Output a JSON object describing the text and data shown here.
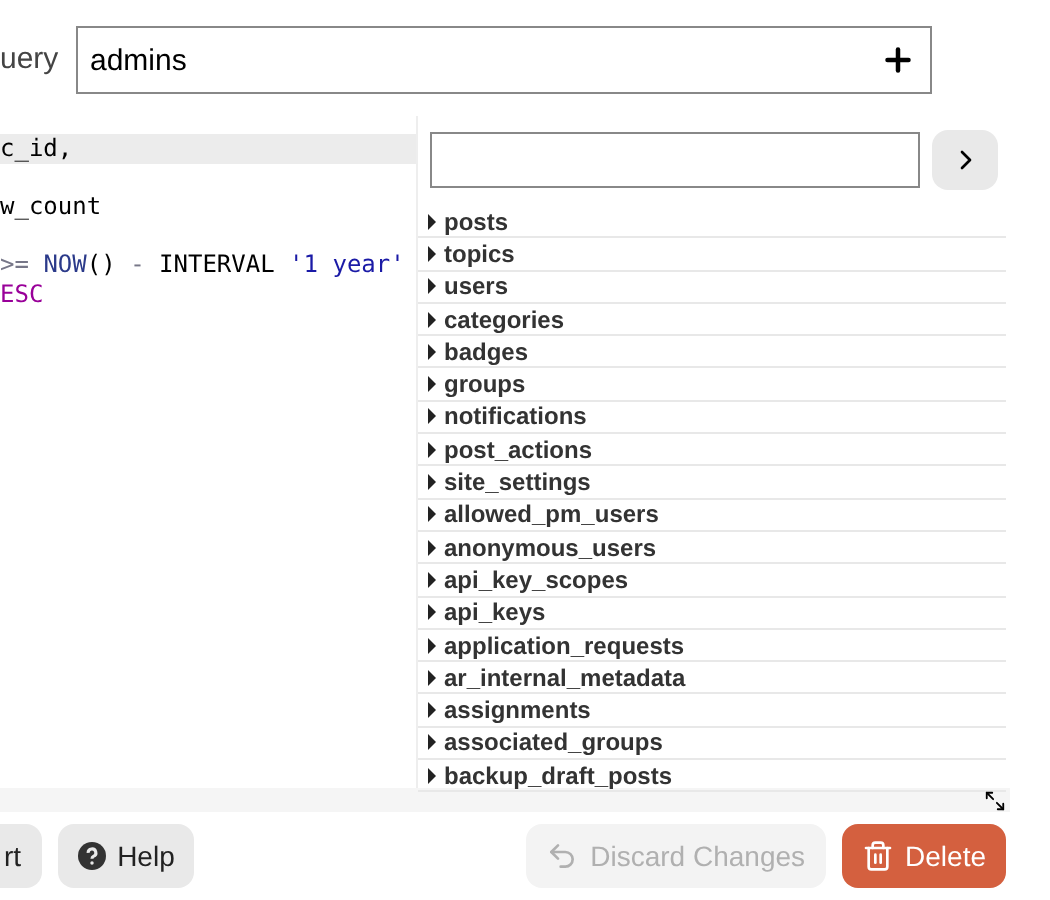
{
  "query_name": {
    "label": "uery",
    "value": "admins"
  },
  "code_lines": [
    {
      "active": true,
      "tokens": [
        {
          "kind": "plain",
          "text": "c_id,"
        }
      ]
    },
    {
      "active": false
    },
    {
      "active": false,
      "tokens": [
        {
          "kind": "plain",
          "text": "w_count"
        }
      ]
    },
    {
      "active": false
    },
    {
      "active": false,
      "tokens": [
        {
          "kind": "operator",
          "text": ">= "
        },
        {
          "kind": "function",
          "text": "NOW"
        },
        {
          "kind": "plain",
          "text": "() "
        },
        {
          "kind": "operator",
          "text": "- "
        },
        {
          "kind": "plain",
          "text": "INTERVAL "
        },
        {
          "kind": "string",
          "text": "'1 year'"
        }
      ]
    },
    {
      "active": false,
      "tokens": [
        {
          "kind": "keyword",
          "text": "ESC"
        }
      ]
    }
  ],
  "schema": {
    "tables": [
      "posts",
      "topics",
      "users",
      "categories",
      "badges",
      "groups",
      "notifications",
      "post_actions",
      "site_settings",
      "allowed_pm_users",
      "anonymous_users",
      "api_key_scopes",
      "api_keys",
      "application_requests",
      "ar_internal_metadata",
      "assignments",
      "associated_groups",
      "backup_draft_posts"
    ]
  },
  "buttons": [
    {
      "kind": "plain",
      "label": "rt",
      "disabled": false
    },
    {
      "kind": "help",
      "label": "Help",
      "disabled": false
    },
    {
      "kind": "discard",
      "label": "Discard Changes",
      "disabled": true
    },
    {
      "kind": "delete",
      "label": "Delete",
      "disabled": false
    }
  ]
}
